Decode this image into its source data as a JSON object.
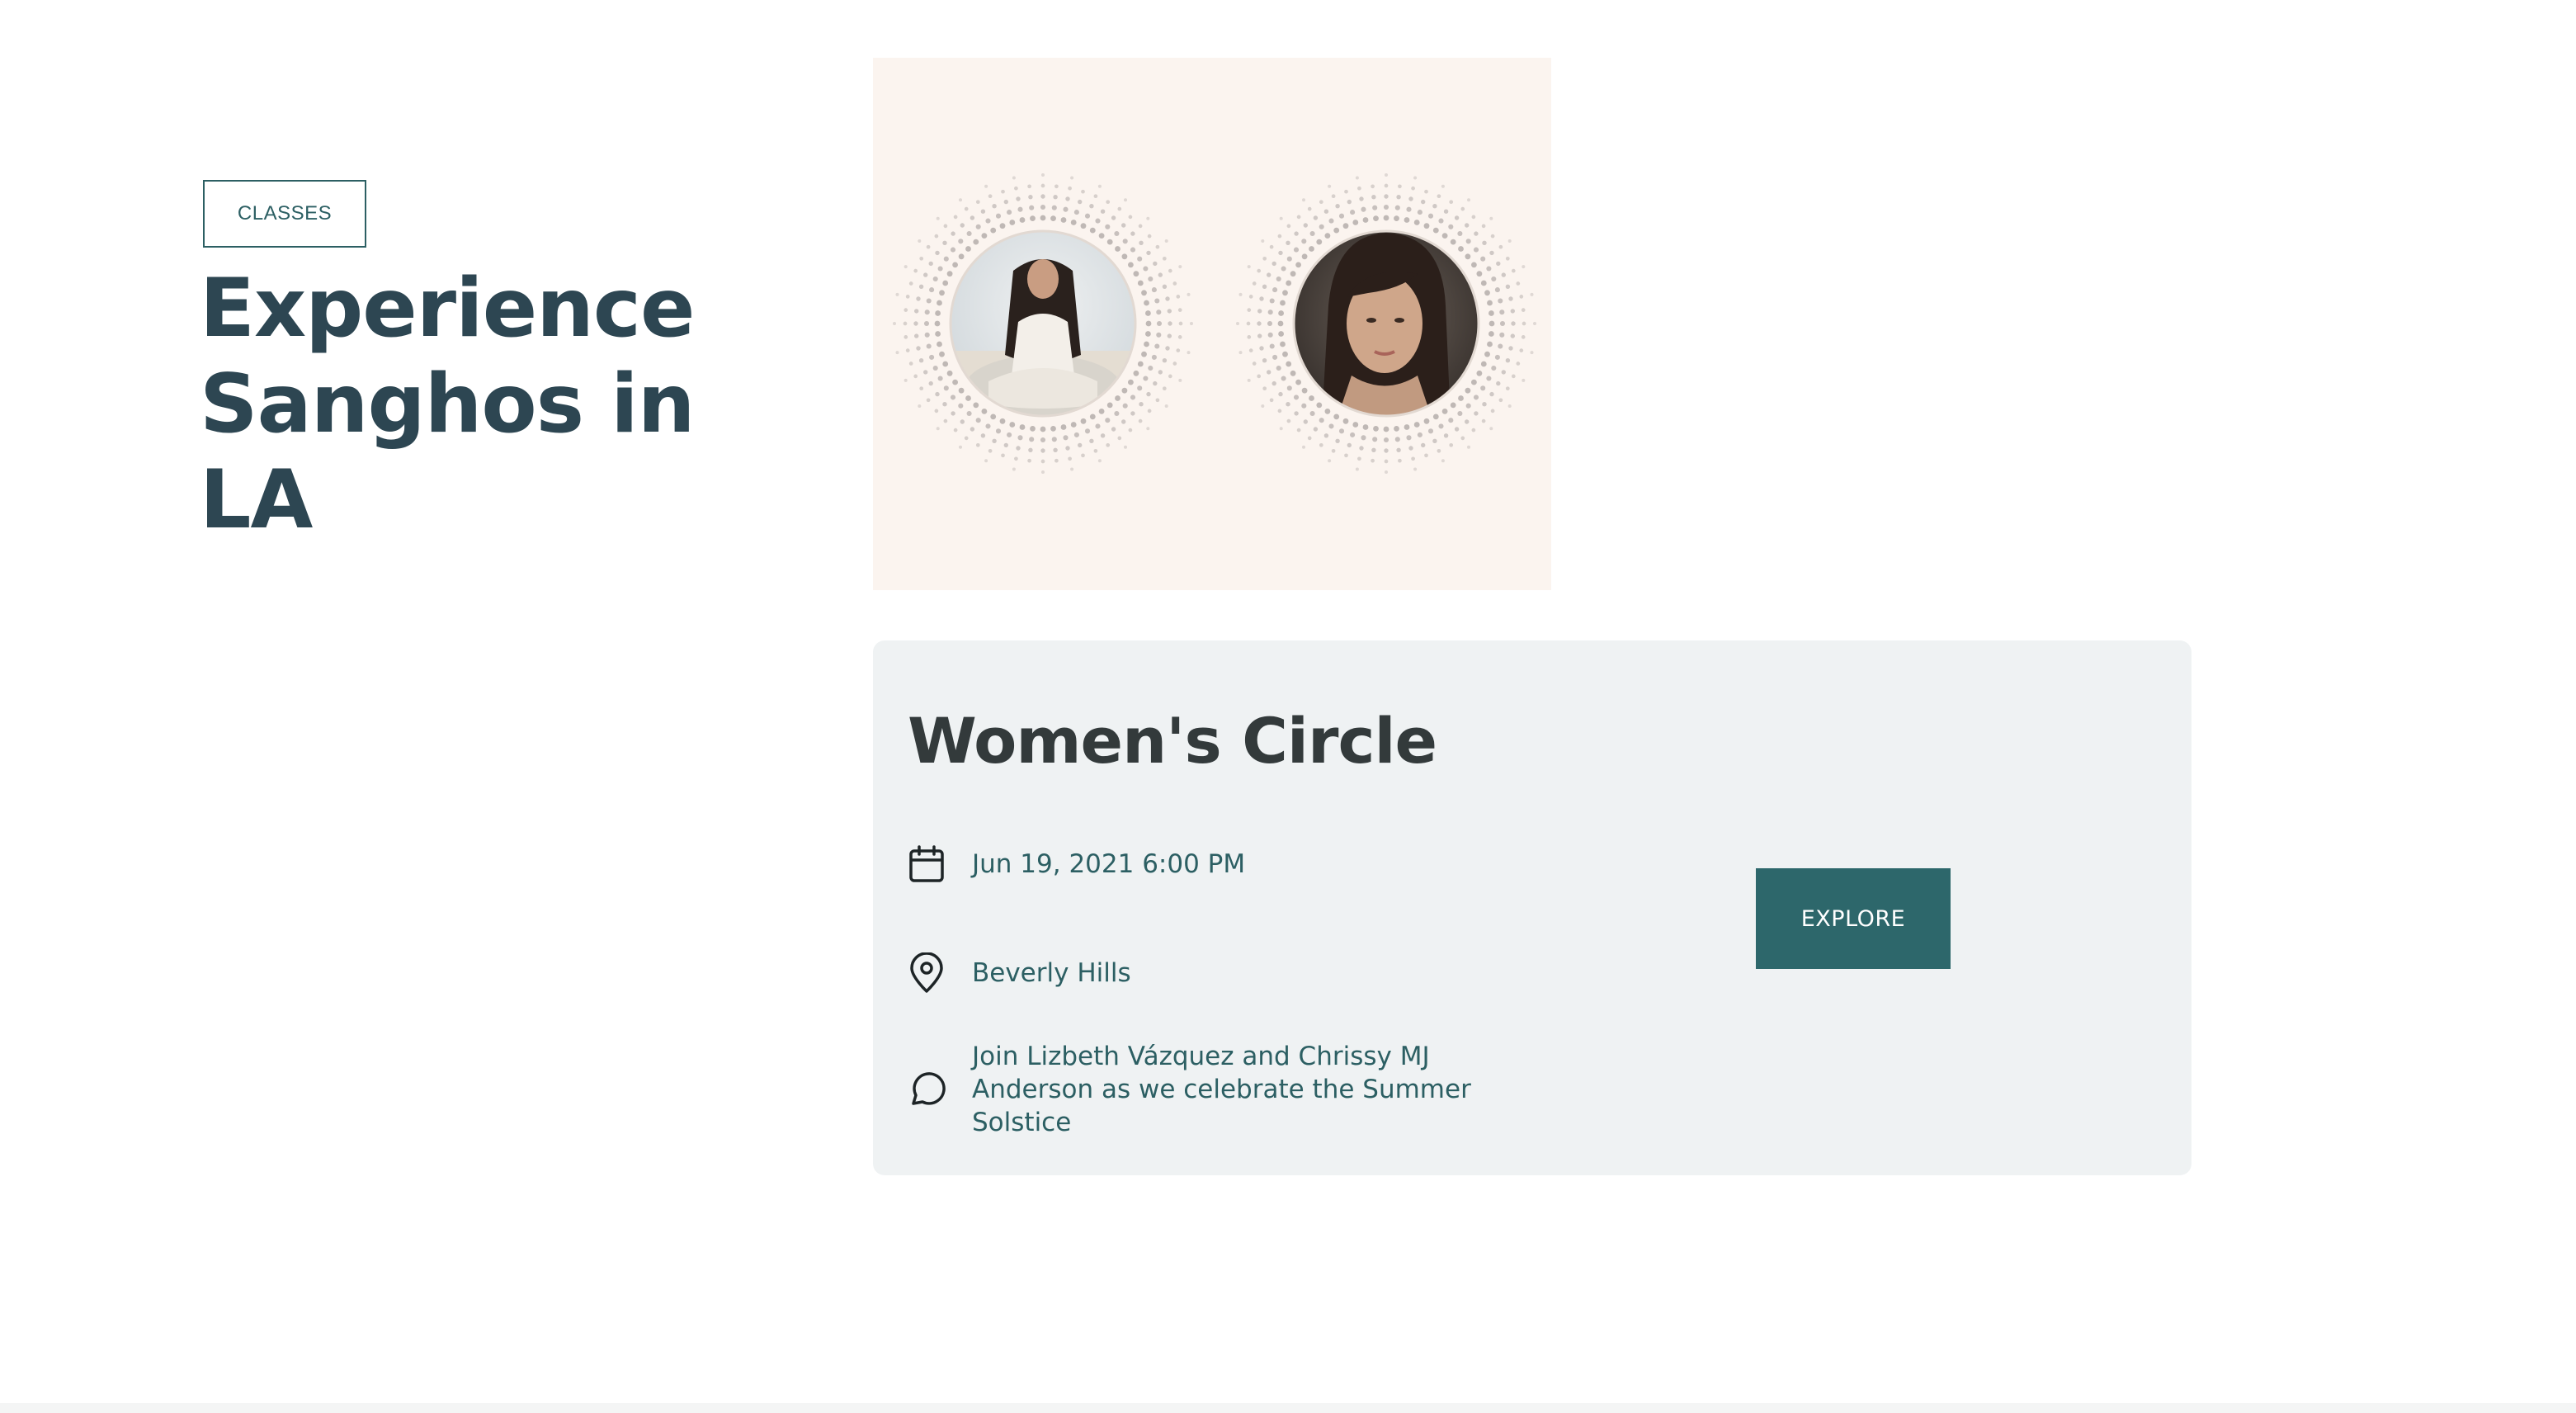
{
  "tag": {
    "label": "CLASSES"
  },
  "page": {
    "title": "Experience Sanghos in LA"
  },
  "hero": {
    "background": "#fbf4ef",
    "avatars": [
      {
        "name": "avatar-left",
        "ray_color": "#b8b1ae"
      },
      {
        "name": "avatar-right",
        "ray_color": "#b8b1ae"
      }
    ]
  },
  "event": {
    "title": "Women's Circle",
    "date": "Jun 19, 2021 6:00 PM",
    "date_icon": "calendar-icon",
    "location": "Beverly Hills",
    "location_icon": "location-pin-icon",
    "description": "Join Lizbeth Vázquez and Chrissy MJ Anderson as we celebrate the Summer Solstice",
    "description_icon": "chat-bubble-icon",
    "cta_label": "EXPLORE"
  },
  "colors": {
    "accent": "#2d676b",
    "heading": "#2d4652",
    "card_background": "#eff2f3",
    "text": "#2c5f63"
  }
}
